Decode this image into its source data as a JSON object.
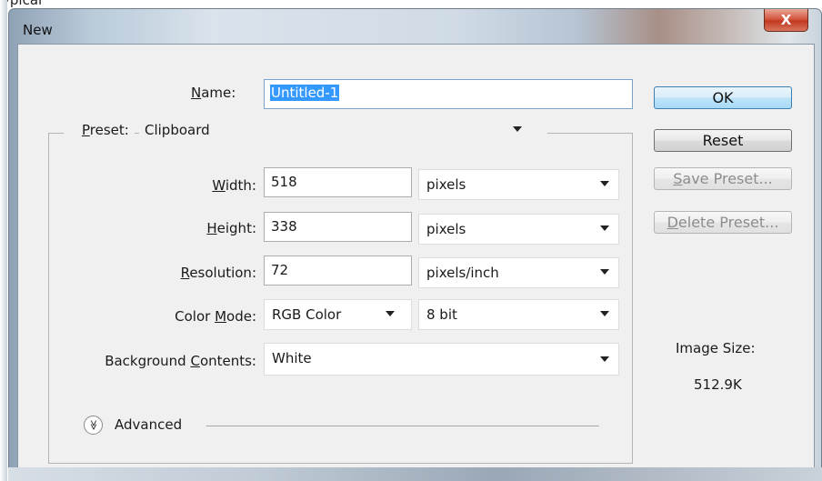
{
  "crop_text": "ypical",
  "window": {
    "title": "New",
    "close_glyph": "X"
  },
  "name_field": {
    "label_pre": "",
    "label_u": "N",
    "label_post": "ame:",
    "value": "Untitled-1"
  },
  "preset": {
    "label_u": "P",
    "label_post": "reset:",
    "value": "Clipboard"
  },
  "width": {
    "label_u": "W",
    "label_post": "idth:",
    "value": "518",
    "unit": "pixels"
  },
  "height": {
    "label_u": "H",
    "label_post": "eight:",
    "value": "338",
    "unit": "pixels"
  },
  "resolution": {
    "label_u": "R",
    "label_post": "esolution:",
    "value": "72",
    "unit": "pixels/inch"
  },
  "color_mode": {
    "label_pre": "Color ",
    "label_u": "M",
    "label_post": "ode:",
    "value": "RGB Color",
    "depth": "8 bit"
  },
  "background": {
    "label_pre": "Background ",
    "label_u": "C",
    "label_post": "ontents:",
    "value": "White"
  },
  "advanced": {
    "label": "Advanced",
    "icon_glyph": "≫"
  },
  "buttons": {
    "ok": "OK",
    "reset": "Reset",
    "save_preset_u": "S",
    "save_preset_post": "ave Preset...",
    "delete_preset_u": "D",
    "delete_preset_post": "elete Preset..."
  },
  "image_size": {
    "label": "Image Size:",
    "value": "512.9K"
  },
  "colors": {
    "accent": "#3399ff",
    "ok_border": "#3c7fb1",
    "close_red": "#c23a20"
  },
  "icons": [
    "close-icon",
    "dropdown-caret-icon",
    "chevron-double-down-icon"
  ]
}
